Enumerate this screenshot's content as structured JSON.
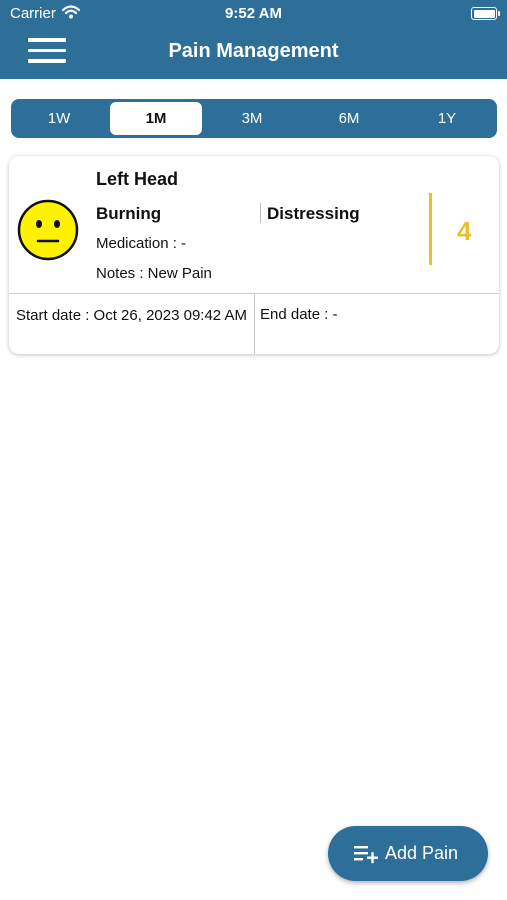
{
  "status_bar": {
    "carrier": "Carrier",
    "wifi_icon": "wifi-icon",
    "time": "9:52 AM",
    "battery_icon": "battery-icon"
  },
  "header": {
    "title": "Pain Management",
    "menu_icon": "hamburger-menu-icon",
    "color": "#2e6f99"
  },
  "range_tabs": {
    "items": [
      "1W",
      "1M",
      "3M",
      "6M",
      "1Y"
    ],
    "selected": "1M"
  },
  "pain_entry": {
    "location": "Left Head",
    "face_icon": "neutral-face-icon",
    "pain_type": "Burning",
    "severity_label": "Distressing",
    "medication": "Medication : -",
    "notes": "Notes : New Pain",
    "score": "4",
    "score_color": "#e6c02f",
    "start_date": "Start date : Oct 26, 2023 09:42 AM",
    "end_date": "End date : -"
  },
  "add_button": {
    "label": "Add Pain",
    "icon": "add-list-icon"
  }
}
